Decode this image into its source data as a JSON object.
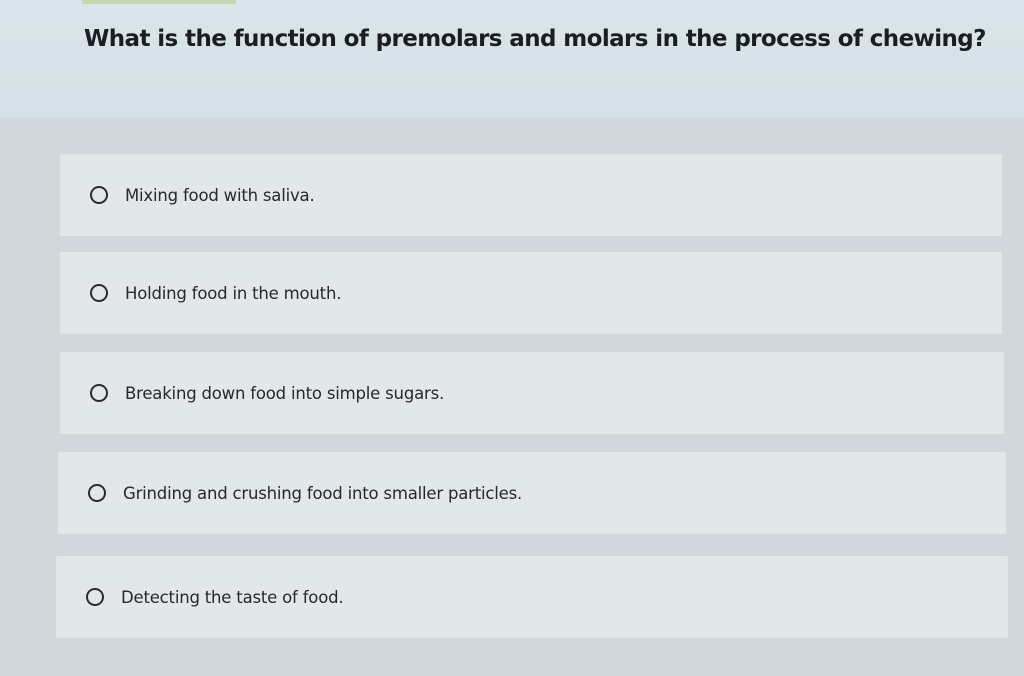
{
  "question": {
    "text": "What is the function of premolars and molars in the process of chewing?"
  },
  "options": [
    {
      "label": "Mixing food with saliva."
    },
    {
      "label": "Holding food in the mouth."
    },
    {
      "label": "Breaking down food into simple sugars."
    },
    {
      "label": "Grinding and crushing food into smaller particles."
    },
    {
      "label": "Detecting the taste of food."
    }
  ]
}
